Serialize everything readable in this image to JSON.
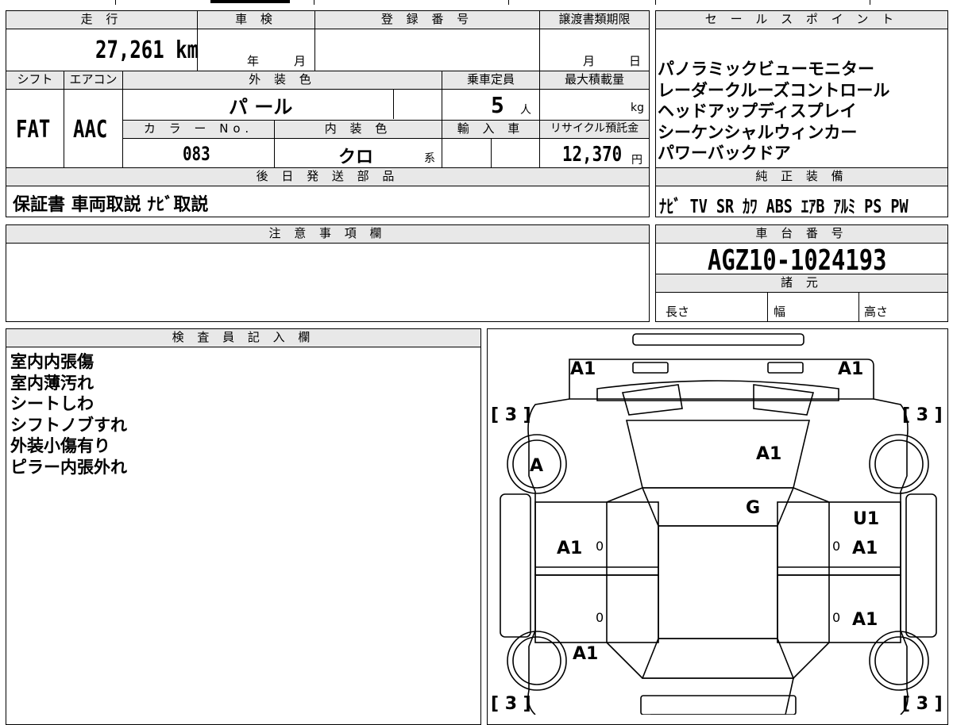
{
  "info": {
    "mileage_label": "走 行",
    "mileage_value": "27,261",
    "mileage_unit": "km",
    "inspection_label": "車 検",
    "inspection_year": "年",
    "inspection_month": "月",
    "registration_label": "登 録 番 号",
    "transfer_label": "譲渡書類期限",
    "transfer_month": "月",
    "transfer_day": "日",
    "shift_label": "シフト",
    "shift_value": "FAT",
    "ac_label": "エアコン",
    "ac_value": "AAC",
    "exterior_color_label": "外 装 色",
    "exterior_color_value": "パ ール",
    "capacity_label": "乗車定員",
    "capacity_value": "5",
    "capacity_unit": "人",
    "load_label": "最大積載量",
    "load_unit": "kg",
    "color_no_label": "カ ラ ー No.",
    "color_no_value": "083",
    "interior_color_label": "内 装 色",
    "interior_color_value": "クロ",
    "interior_color_suffix": "系",
    "import_label": "輸 入 車",
    "recycle_label": "リサイクル預託金",
    "recycle_value": "12,370",
    "recycle_unit": "円",
    "later_parts_label": "後 日 発 送 部 品",
    "later_parts_value": "保証書 車両取説 ﾅﾋﾞ取説"
  },
  "sales": {
    "label": "セ ー ル ス ポ イ ン ト",
    "points": [
      "パノラミックビューモニター",
      "レーダークルーズコントロール",
      "ヘッドアップディスプレイ",
      "シーケンシャルウィンカー",
      "パワーバックドア"
    ],
    "equip_label": "純 正 装 備",
    "equip_value": "ﾅﾋﾞ TV SR ｶﾜ ABS ｴｱB ｱﾙﾐ PS PW"
  },
  "notes": {
    "label": "注 意 事 項 欄"
  },
  "chassis": {
    "label": "車 台 番 号",
    "value": "AGZ10-1024193",
    "spec_label": "諸 元",
    "length_label": "長さ",
    "width_label": "幅",
    "height_label": "高さ"
  },
  "inspector": {
    "label": "検 査 員 記 入 欄",
    "lines": [
      "室内内張傷",
      "室内薄汚れ",
      "シートしわ",
      "シフトノブすれ",
      "外装小傷有り",
      "ピラー内張外れ"
    ]
  },
  "diagram": {
    "marks": {
      "front_left": "A1",
      "front_right": "A1",
      "hood": "A1",
      "windshield": "G",
      "front_wheel_left": "A",
      "front_door_left": "A1",
      "front_door_right_u": "U1",
      "front_door_right": "A1",
      "rear_door_right": "A1",
      "rear_quarter_left": "A1",
      "zero_fl": "0",
      "zero_fr": "0",
      "zero_rl": "0",
      "zero_rr": "0"
    },
    "tires": {
      "front_left": "[ 3 ]",
      "front_right": "[ 3 ]",
      "rear_left": "[ 3 ]",
      "rear_right": "[ 3 ]"
    }
  }
}
